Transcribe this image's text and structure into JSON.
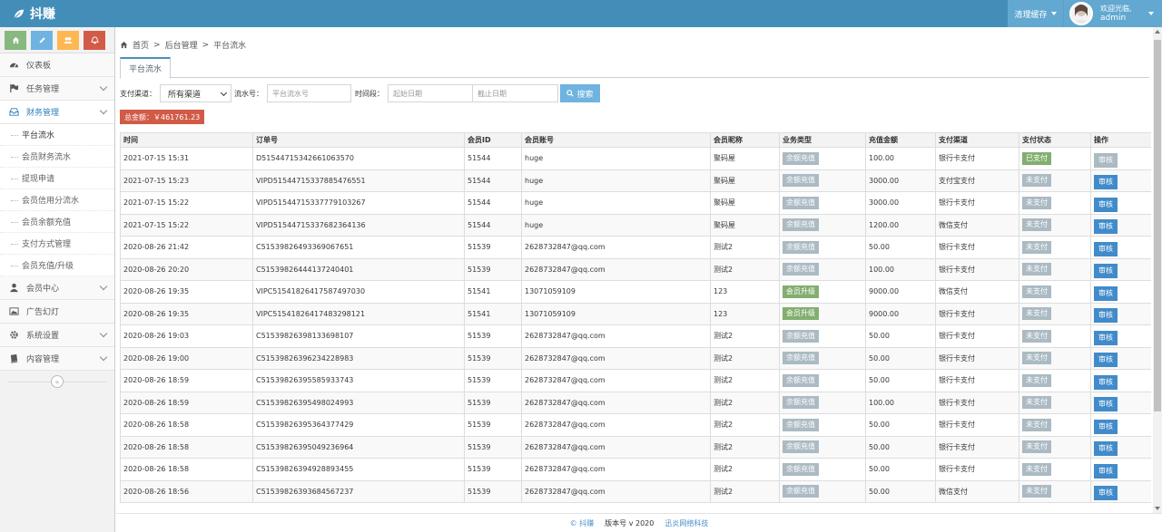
{
  "brand": {
    "name": "抖赚"
  },
  "topbar": {
    "clear_cache": "清理缓存",
    "welcome": "欢迎光临,",
    "username": "admin"
  },
  "sidebar": {
    "menu": [
      {
        "label": "仪表板",
        "icon": "dashboard-icon"
      },
      {
        "label": "任务管理",
        "icon": "flag-icon"
      },
      {
        "label": "财务管理",
        "icon": "inbox-icon"
      }
    ],
    "finance_sub": [
      "平台流水",
      "会员财务流水",
      "提现申请",
      "会员信用分流水",
      "会员余额充值",
      "支付方式管理",
      "会员充值/升级"
    ],
    "menu_after": [
      {
        "label": "会员中心",
        "icon": "user-icon"
      },
      {
        "label": "广告幻灯",
        "icon": "picture-icon"
      },
      {
        "label": "系统设置",
        "icon": "cog-icon"
      },
      {
        "label": "内容管理",
        "icon": "book-icon"
      }
    ]
  },
  "breadcrumb": {
    "home": "首页",
    "sep1": ">",
    "level2": "后台管理",
    "sep2": ">",
    "current": "平台流水"
  },
  "tab": {
    "label": "平台流水"
  },
  "filters": {
    "channel_label": "支付渠道：",
    "channel_value": "所有渠道",
    "serial_label": "流水号：",
    "serial_placeholder": "平台流水号",
    "period_label": "时间段：",
    "start_placeholder": "起始日期",
    "end_placeholder": "截止日期",
    "search_label": "搜索"
  },
  "total": {
    "text": "总金额：￥461761.23"
  },
  "table": {
    "headers": [
      "时间",
      "订单号",
      "会员ID",
      "会员账号",
      "会员昵称",
      "业务类型",
      "充值金额",
      "支付渠道",
      "支付状态",
      "操作"
    ],
    "rows": [
      [
        "2021-07-15 15:31",
        "D51544715342661063570",
        "51544",
        "huge",
        "聚码屋",
        "余额充值",
        "100.00",
        "银行卡支付",
        "已支付",
        "审核"
      ],
      [
        "2021-07-15 15:23",
        "VIPD51544715337885476551",
        "51544",
        "huge",
        "聚码屋",
        "余额充值",
        "3000.00",
        "支付宝支付",
        "未支付",
        "审核"
      ],
      [
        "2021-07-15 15:22",
        "VIPD51544715337779103267",
        "51544",
        "huge",
        "聚码屋",
        "余额充值",
        "3000.00",
        "银行卡支付",
        "未支付",
        "审核"
      ],
      [
        "2021-07-15 15:22",
        "VIPD51544715337682364136",
        "51544",
        "huge",
        "聚码屋",
        "余额充值",
        "1200.00",
        "微信支付",
        "未支付",
        "审核"
      ],
      [
        "2020-08-26 21:42",
        "C51539826493369067651",
        "51539",
        "2628732847@qq.com",
        "测试2",
        "余额充值",
        "50.00",
        "银行卡支付",
        "未支付",
        "审核"
      ],
      [
        "2020-08-26 20:20",
        "C51539826444137240401",
        "51539",
        "2628732847@qq.com",
        "测试2",
        "余额充值",
        "100.00",
        "银行卡支付",
        "未支付",
        "审核"
      ],
      [
        "2020-08-26 19:35",
        "VIPC51541826417587497030",
        "51541",
        "13071059109",
        "123",
        "会员升级",
        "9000.00",
        "微信支付",
        "未支付",
        "审核"
      ],
      [
        "2020-08-26 19:35",
        "VIPC51541826417483298121",
        "51541",
        "13071059109",
        "123",
        "会员升级",
        "9000.00",
        "银行卡支付",
        "未支付",
        "审核"
      ],
      [
        "2020-08-26 19:03",
        "C51539826398133698107",
        "51539",
        "2628732847@qq.com",
        "测试2",
        "余额充值",
        "50.00",
        "银行卡支付",
        "未支付",
        "审核"
      ],
      [
        "2020-08-26 19:00",
        "C51539826396234228983",
        "51539",
        "2628732847@qq.com",
        "测试2",
        "余额充值",
        "50.00",
        "银行卡支付",
        "未支付",
        "审核"
      ],
      [
        "2020-08-26 18:59",
        "C51539826395585933743",
        "51539",
        "2628732847@qq.com",
        "测试2",
        "余额充值",
        "50.00",
        "银行卡支付",
        "未支付",
        "审核"
      ],
      [
        "2020-08-26 18:59",
        "C51539826395498024993",
        "51539",
        "2628732847@qq.com",
        "测试2",
        "余额充值",
        "100.00",
        "银行卡支付",
        "未支付",
        "审核"
      ],
      [
        "2020-08-26 18:58",
        "C51539826395364377429",
        "51539",
        "2628732847@qq.com",
        "测试2",
        "余额充值",
        "50.00",
        "银行卡支付",
        "未支付",
        "审核"
      ],
      [
        "2020-08-26 18:58",
        "C51539826395049236964",
        "51539",
        "2628732847@qq.com",
        "测试2",
        "余额充值",
        "50.00",
        "银行卡支付",
        "未支付",
        "审核"
      ],
      [
        "2020-08-26 18:58",
        "C51539826394928893455",
        "51539",
        "2628732847@qq.com",
        "测试2",
        "余额充值",
        "50.00",
        "银行卡支付",
        "未支付",
        "审核"
      ],
      [
        "2020-08-26 18:56",
        "C51539826393684567237",
        "51539",
        "2628732847@qq.com",
        "测试2",
        "余额充值",
        "50.00",
        "微信支付",
        "未支付",
        "审核"
      ]
    ]
  },
  "footer": {
    "copyright": "© 抖赚",
    "version": "版本号 v 2020",
    "company": "迅炎网络科技"
  },
  "colors": {
    "navbar": "#438eb9",
    "accent": "#62a8d1",
    "danger": "#d15b47",
    "success": "#82af6f",
    "muted": "#abbac3",
    "primary": "#428bca"
  }
}
